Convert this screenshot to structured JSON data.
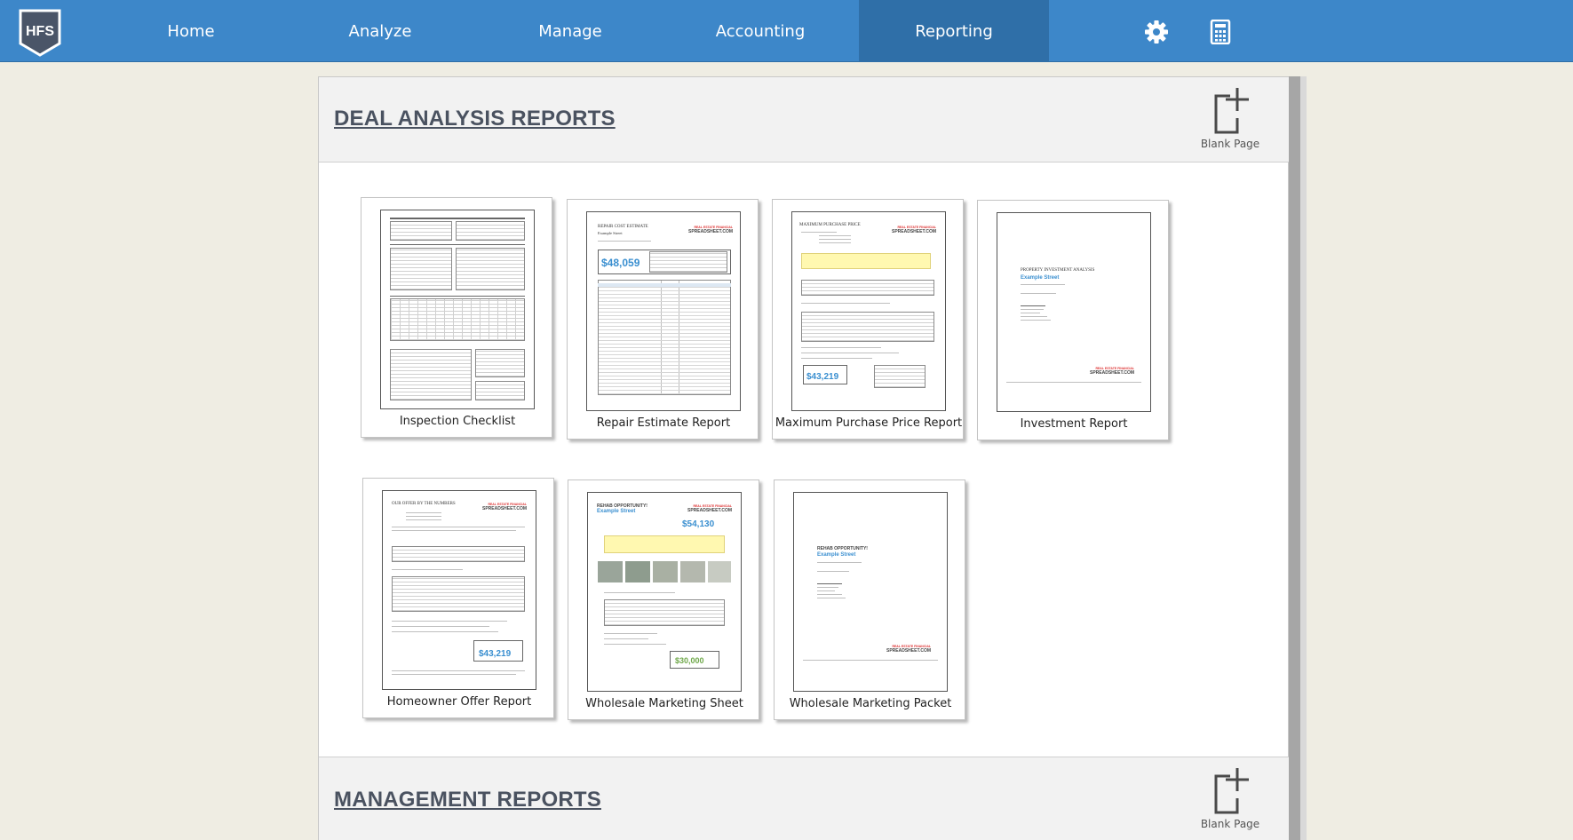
{
  "nav": {
    "logo_text": "HFS",
    "items": [
      {
        "label": "Home"
      },
      {
        "label": "Analyze"
      },
      {
        "label": "Manage"
      },
      {
        "label": "Accounting"
      },
      {
        "label": "Reporting",
        "active": true
      }
    ],
    "icons": [
      "gear-icon",
      "calculator-icon"
    ],
    "colors": {
      "bar": "#3d87c9",
      "active": "#2f6fa8"
    }
  },
  "sections": [
    {
      "title": "DEAL ANALYSIS REPORTS",
      "blank_label": "Blank Page",
      "reports": [
        {
          "label": "Inspection Checklist"
        },
        {
          "label": "Repair Estimate Report",
          "thumb_title": "REPAIR COST ESTIMATE",
          "thumb_sub": "Example Street",
          "thumb_value": "$48,059"
        },
        {
          "label": "Maximum Purchase Price Report",
          "thumb_title": "MAXIMUM PURCHASE PRICE",
          "thumb_value": "$43,219"
        },
        {
          "label": "Investment Report",
          "thumb_title": "PROPERTY INVESTMENT ANALYSIS",
          "thumb_sub": "Example Street"
        },
        {
          "label": "Homeowner Offer Report",
          "thumb_title": "OUR OFFER BY THE NUMBERS",
          "thumb_value": "$43,219"
        },
        {
          "label": "Wholesale Marketing Sheet",
          "thumb_title": "REHAB OPPORTUNITY!",
          "thumb_sub": "Example Street",
          "thumb_value": "$54,130",
          "thumb_value2": "$30,000"
        },
        {
          "label": "Wholesale Marketing Packet",
          "thumb_title": "REHAB OPPORTUNITY!",
          "thumb_sub": "Example Street"
        }
      ]
    },
    {
      "title": "MANAGEMENT REPORTS",
      "blank_label": "Blank Page"
    }
  ],
  "brand": {
    "top": "REAL ESTATE FINANCIAL",
    "name": "SPREADSHEET.COM"
  }
}
